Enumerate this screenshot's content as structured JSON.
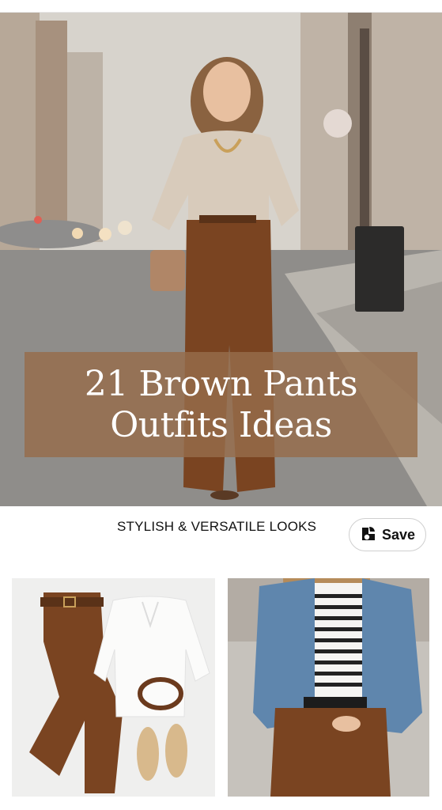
{
  "pin": {
    "title_lines": [
      "21 Brown Pants",
      "Outfits Ideas"
    ],
    "subtitle": "STYLISH & VERSATILE LOOKS",
    "save_label": "Save"
  },
  "colors": {
    "title_band": "#966c4b",
    "brown_pants": "#7a4421",
    "sweater": "#d8cbbb"
  },
  "icons": [
    "save-pin-icon"
  ]
}
